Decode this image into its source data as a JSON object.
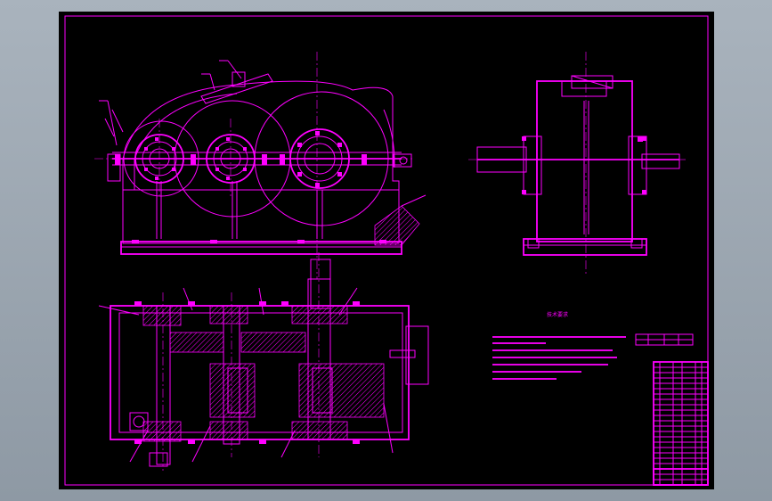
{
  "window": {
    "background": "#9aa5b0"
  },
  "drawing": {
    "line_color": "#ff00ff",
    "paper_color": "#000000",
    "views": [
      "front-view",
      "side-view",
      "top-section-view",
      "technical-requirements",
      "parts-list",
      "title-block"
    ]
  },
  "technical_requirements": {
    "title": "技术要求"
  }
}
